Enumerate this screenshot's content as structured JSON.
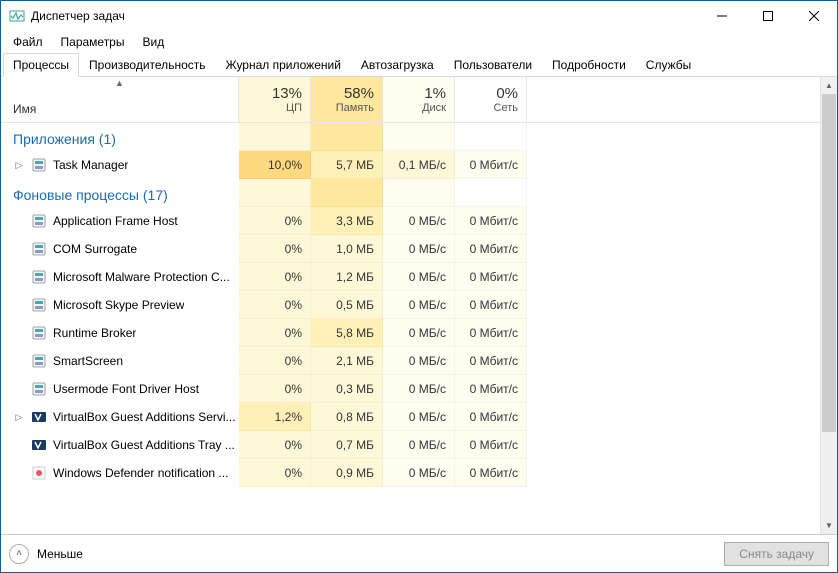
{
  "title": "Диспетчер задач",
  "menus": {
    "file": "Файл",
    "options": "Параметры",
    "view": "Вид"
  },
  "tabs": {
    "processes": "Процессы",
    "performance": "Производительность",
    "app_history": "Журнал приложений",
    "startup": "Автозагрузка",
    "users": "Пользователи",
    "details": "Подробности",
    "services": "Службы"
  },
  "columns": {
    "name": "Имя",
    "cpu": {
      "pct": "13%",
      "label": "ЦП"
    },
    "mem": {
      "pct": "58%",
      "label": "Память"
    },
    "disk": {
      "pct": "1%",
      "label": "Диск"
    },
    "net": {
      "pct": "0%",
      "label": "Сеть"
    }
  },
  "groups": {
    "apps": "Приложения (1)",
    "bg": "Фоновые процессы (17)"
  },
  "rows": [
    {
      "group": "apps",
      "expand": true,
      "name": "Task Manager",
      "cpu": "10,0%",
      "mem": "5,7 МБ",
      "disk": "0,1 МБ/с",
      "net": "0 Мбит/с",
      "heat": {
        "cpu": 4,
        "mem": 2,
        "disk": 1,
        "net": 0
      }
    },
    {
      "group": "bg",
      "name": "Application Frame Host",
      "cpu": "0%",
      "mem": "3,3 МБ",
      "disk": "0 МБ/с",
      "net": "0 Мбит/с",
      "heat": {
        "cpu": 1,
        "mem": 2,
        "disk": 0,
        "net": 0
      }
    },
    {
      "group": "bg",
      "name": "COM Surrogate",
      "cpu": "0%",
      "mem": "1,0 МБ",
      "disk": "0 МБ/с",
      "net": "0 Мбит/с",
      "heat": {
        "cpu": 1,
        "mem": 1,
        "disk": 0,
        "net": 0
      }
    },
    {
      "group": "bg",
      "name": "Microsoft Malware Protection C...",
      "cpu": "0%",
      "mem": "1,2 МБ",
      "disk": "0 МБ/с",
      "net": "0 Мбит/с",
      "heat": {
        "cpu": 1,
        "mem": 1,
        "disk": 0,
        "net": 0
      }
    },
    {
      "group": "bg",
      "name": "Microsoft Skype Preview",
      "cpu": "0%",
      "mem": "0,5 МБ",
      "disk": "0 МБ/с",
      "net": "0 Мбит/с",
      "heat": {
        "cpu": 1,
        "mem": 1,
        "disk": 0,
        "net": 0
      }
    },
    {
      "group": "bg",
      "name": "Runtime Broker",
      "cpu": "0%",
      "mem": "5,8 МБ",
      "disk": "0 МБ/с",
      "net": "0 Мбит/с",
      "heat": {
        "cpu": 1,
        "mem": 2,
        "disk": 0,
        "net": 0
      }
    },
    {
      "group": "bg",
      "name": "SmartScreen",
      "cpu": "0%",
      "mem": "2,1 МБ",
      "disk": "0 МБ/с",
      "net": "0 Мбит/с",
      "heat": {
        "cpu": 1,
        "mem": 1,
        "disk": 0,
        "net": 0
      }
    },
    {
      "group": "bg",
      "name": "Usermode Font Driver Host",
      "cpu": "0%",
      "mem": "0,3 МБ",
      "disk": "0 МБ/с",
      "net": "0 Мбит/с",
      "heat": {
        "cpu": 1,
        "mem": 1,
        "disk": 0,
        "net": 0
      }
    },
    {
      "group": "bg",
      "expand": true,
      "name": "VirtualBox Guest Additions Servi...",
      "cpu": "1,2%",
      "mem": "0,8 МБ",
      "disk": "0 МБ/с",
      "net": "0 Мбит/с",
      "heat": {
        "cpu": 2,
        "mem": 1,
        "disk": 0,
        "net": 0
      }
    },
    {
      "group": "bg",
      "name": "VirtualBox Guest Additions Tray ...",
      "cpu": "0%",
      "mem": "0,7 МБ",
      "disk": "0 МБ/с",
      "net": "0 Мбит/с",
      "heat": {
        "cpu": 1,
        "mem": 1,
        "disk": 0,
        "net": 0
      }
    },
    {
      "group": "bg",
      "name": "Windows Defender notification ...",
      "cpu": "0%",
      "mem": "0,9 МБ",
      "disk": "0 МБ/с",
      "net": "0 Мбит/с",
      "heat": {
        "cpu": 1,
        "mem": 1,
        "disk": 0,
        "net": 0
      }
    }
  ],
  "footer": {
    "less": "Меньше",
    "end_task": "Снять задачу"
  }
}
